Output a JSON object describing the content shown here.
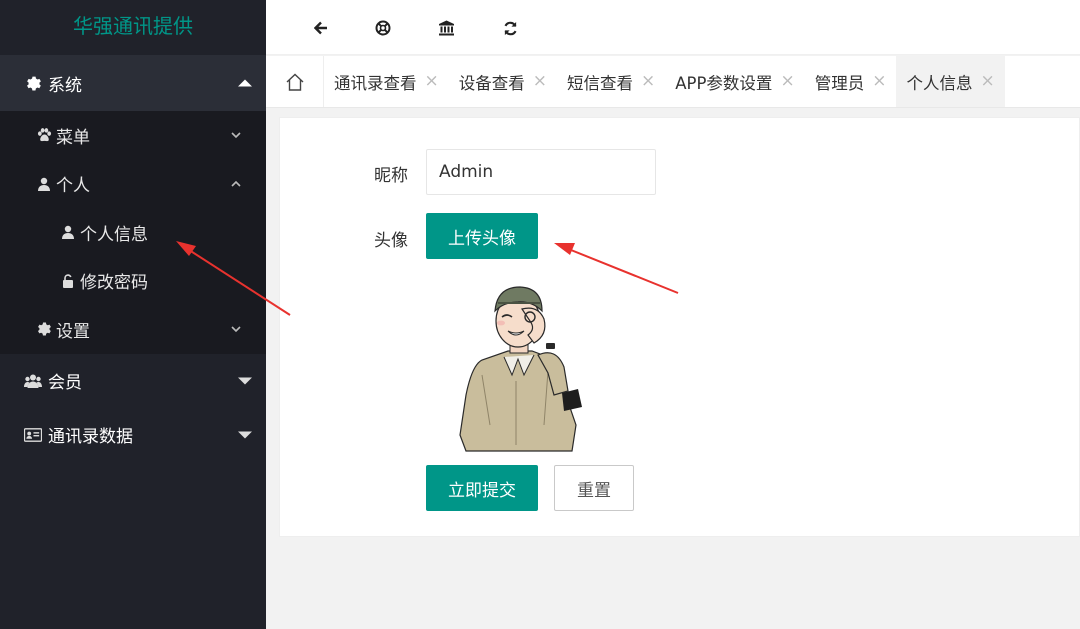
{
  "app": {
    "title": "华强通讯提供"
  },
  "sidebar": {
    "system": {
      "label": "系统"
    },
    "menu": {
      "label": "菜单"
    },
    "personal": {
      "label": "个人"
    },
    "personal_info": {
      "label": "个人信息"
    },
    "change_password": {
      "label": "修改密码"
    },
    "settings": {
      "label": "设置"
    },
    "members": {
      "label": "会员"
    },
    "contacts_data": {
      "label": "通讯录数据"
    }
  },
  "tabs": [
    {
      "label": "通讯录查看"
    },
    {
      "label": "设备查看"
    },
    {
      "label": "短信查看"
    },
    {
      "label": "APP参数设置"
    },
    {
      "label": "管理员"
    },
    {
      "label": "个人信息"
    }
  ],
  "form": {
    "nickname_label": "昵称",
    "nickname_value": "Admin",
    "avatar_label": "头像",
    "upload_button": "上传头像",
    "submit_button": "立即提交",
    "reset_button": "重置"
  },
  "colors": {
    "accent": "#009688",
    "sidebar": "#20222a",
    "annotation": "#e8322e"
  },
  "icons": {
    "toolbar": [
      "arrow-left-icon",
      "lifebuoy-icon",
      "bank-icon",
      "refresh-icon"
    ],
    "tabs_home": "home-icon"
  }
}
